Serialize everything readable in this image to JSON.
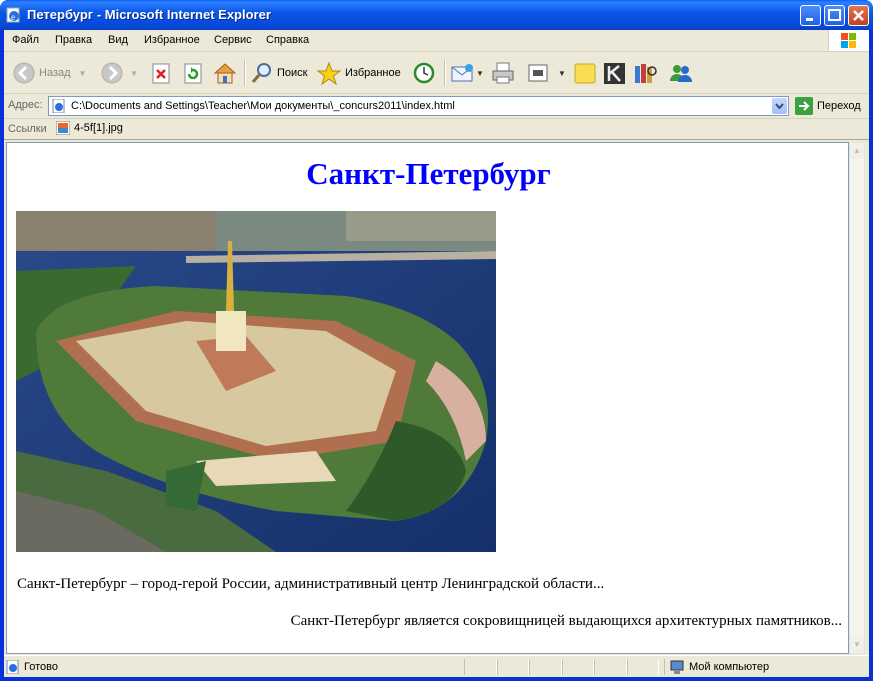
{
  "window": {
    "title": "Петербург - Microsoft Internet Explorer"
  },
  "menu": [
    "Файл",
    "Правка",
    "Вид",
    "Избранное",
    "Сервис",
    "Справка"
  ],
  "toolbar": {
    "back_label": "Назад",
    "search_label": "Поиск",
    "favorites_label": "Избранное"
  },
  "address": {
    "label": "Адрес:",
    "url": "C:\\Documents and Settings\\Teacher\\Мои документы\\_concurs2011\\index.html",
    "go_label": "Переход"
  },
  "links": {
    "label": "Ссылки",
    "items": [
      "4-5f[1].jpg"
    ]
  },
  "page": {
    "heading": "Санкт-Петербург",
    "paragraph1": "Санкт-Петербург – город-герой России, административный центр Ленинградской области...",
    "paragraph2": "Санкт-Петербург является сокровищницей выдающихся архитектурных памятников..."
  },
  "status": {
    "text": "Готово",
    "zone": "Мой компьютер"
  }
}
